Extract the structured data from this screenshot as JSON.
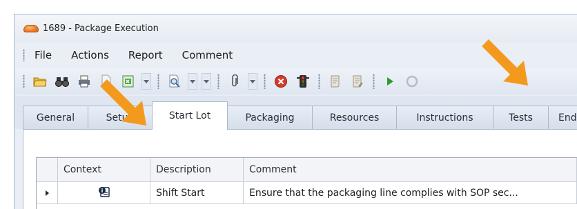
{
  "window": {
    "title": "1689 - Package Execution",
    "app_icon": "cloud-app-icon"
  },
  "menubar": {
    "items": [
      "File",
      "Actions",
      "Report",
      "Comment"
    ]
  },
  "toolbar": {
    "buttons": [
      "open-folder-icon",
      "find-binoculars-icon",
      "print-icon",
      "document-icon",
      "excel-export-icon",
      "print-preview-icon",
      "attachment-paperclip-icon",
      "cancel-red-x-icon",
      "traffic-light-icon",
      "scroll-document-icon",
      "scroll-edit-icon",
      "play-icon",
      "refresh-icon"
    ]
  },
  "tabs": {
    "items": [
      "General",
      "Setup",
      "Start Lot",
      "Packaging",
      "Resources",
      "Instructions",
      "Tests",
      "End"
    ],
    "active": "Start Lot"
  },
  "grid": {
    "columns": [
      "Context",
      "Description",
      "Comment"
    ],
    "rows": [
      {
        "context_icon": "info-note-icon",
        "description": "Shift Start",
        "comment": "Ensure that the packaging line complies with SOP sec..."
      }
    ]
  },
  "colors": {
    "accent_arrow": "#f39a1e",
    "play_green": "#2f9a2f",
    "cancel_red": "#d93a2b"
  }
}
